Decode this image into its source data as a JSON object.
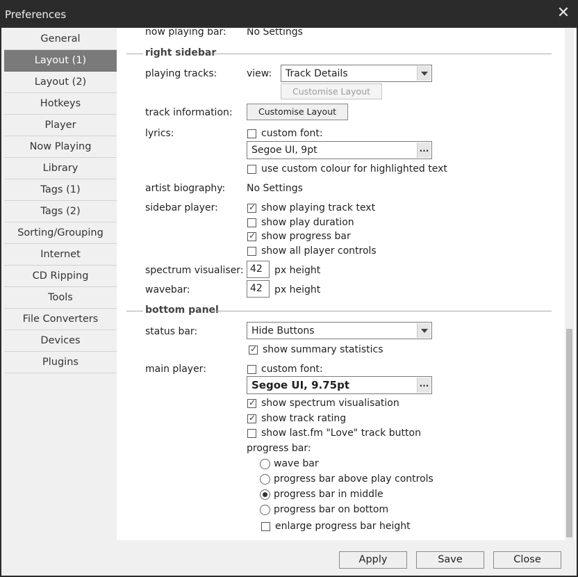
{
  "window": {
    "title": "Preferences",
    "close_glyph": "✕"
  },
  "sidebar": {
    "items": [
      {
        "label": "General"
      },
      {
        "label": "Layout (1)"
      },
      {
        "label": "Layout (2)"
      },
      {
        "label": "Hotkeys"
      },
      {
        "label": "Player"
      },
      {
        "label": "Now Playing"
      },
      {
        "label": "Library"
      },
      {
        "label": "Tags (1)"
      },
      {
        "label": "Tags (2)"
      },
      {
        "label": "Sorting/Grouping"
      },
      {
        "label": "Internet"
      },
      {
        "label": "CD Ripping"
      },
      {
        "label": "Tools"
      },
      {
        "label": "File Converters"
      },
      {
        "label": "Devices"
      },
      {
        "label": "Plugins"
      }
    ],
    "selected": "Layout (1)"
  },
  "content": {
    "now_playing_bar": {
      "label": "now playing bar:",
      "value": "No Settings"
    },
    "right_sidebar": {
      "title": "right sidebar",
      "playing_tracks": {
        "label": "playing tracks:",
        "view_label": "view:",
        "view_value": "Track Details",
        "customise_label": "Customise Layout"
      },
      "track_information": {
        "label": "track information:",
        "customise_label": "Customise Layout"
      },
      "lyrics": {
        "label": "lyrics:",
        "custom_font_label": "custom font:",
        "custom_font_checked": false,
        "font_value": "Segoe UI, 9pt",
        "dots": "...",
        "custom_colour_label": "use custom colour for highlighted text",
        "custom_colour_checked": false
      },
      "artist_biography": {
        "label": "artist biography:",
        "value": "No Settings"
      },
      "sidebar_player": {
        "label": "sidebar player:",
        "options": [
          {
            "label": "show playing track text",
            "checked": true
          },
          {
            "label": "show play duration",
            "checked": false
          },
          {
            "label": "show progress bar",
            "checked": true
          },
          {
            "label": "show all player controls",
            "checked": false
          }
        ]
      },
      "spectrum_visualiser": {
        "label": "spectrum visualiser:",
        "value": "42",
        "unit": "px height"
      },
      "wavebar": {
        "label": "wavebar:",
        "value": "42",
        "unit": "px height"
      }
    },
    "bottom_panel": {
      "title": "bottom panel",
      "status_bar": {
        "label": "status bar:",
        "value": "Hide Buttons",
        "summary_label": "show summary statistics",
        "summary_checked": true
      },
      "main_player": {
        "label": "main player:",
        "custom_font_label": "custom font:",
        "custom_font_checked": false,
        "font_value": "Segoe UI, 9.75pt",
        "dots": "...",
        "options": [
          {
            "label": "show spectrum visualisation",
            "checked": true
          },
          {
            "label": "show track rating",
            "checked": true
          },
          {
            "label": "show last.fm \"Love\" track button",
            "checked": false
          }
        ],
        "progress_bar_label": "progress bar:",
        "progress_options": [
          {
            "label": "wave bar",
            "selected": false
          },
          {
            "label": "progress bar above play controls",
            "selected": false
          },
          {
            "label": "progress bar in middle",
            "selected": true
          },
          {
            "label": "progress bar on bottom",
            "selected": false
          }
        ],
        "enlarge_label": "enlarge progress bar height",
        "enlarge_checked": false
      }
    }
  },
  "footer": {
    "apply": "Apply",
    "save": "Save",
    "close": "Close"
  }
}
